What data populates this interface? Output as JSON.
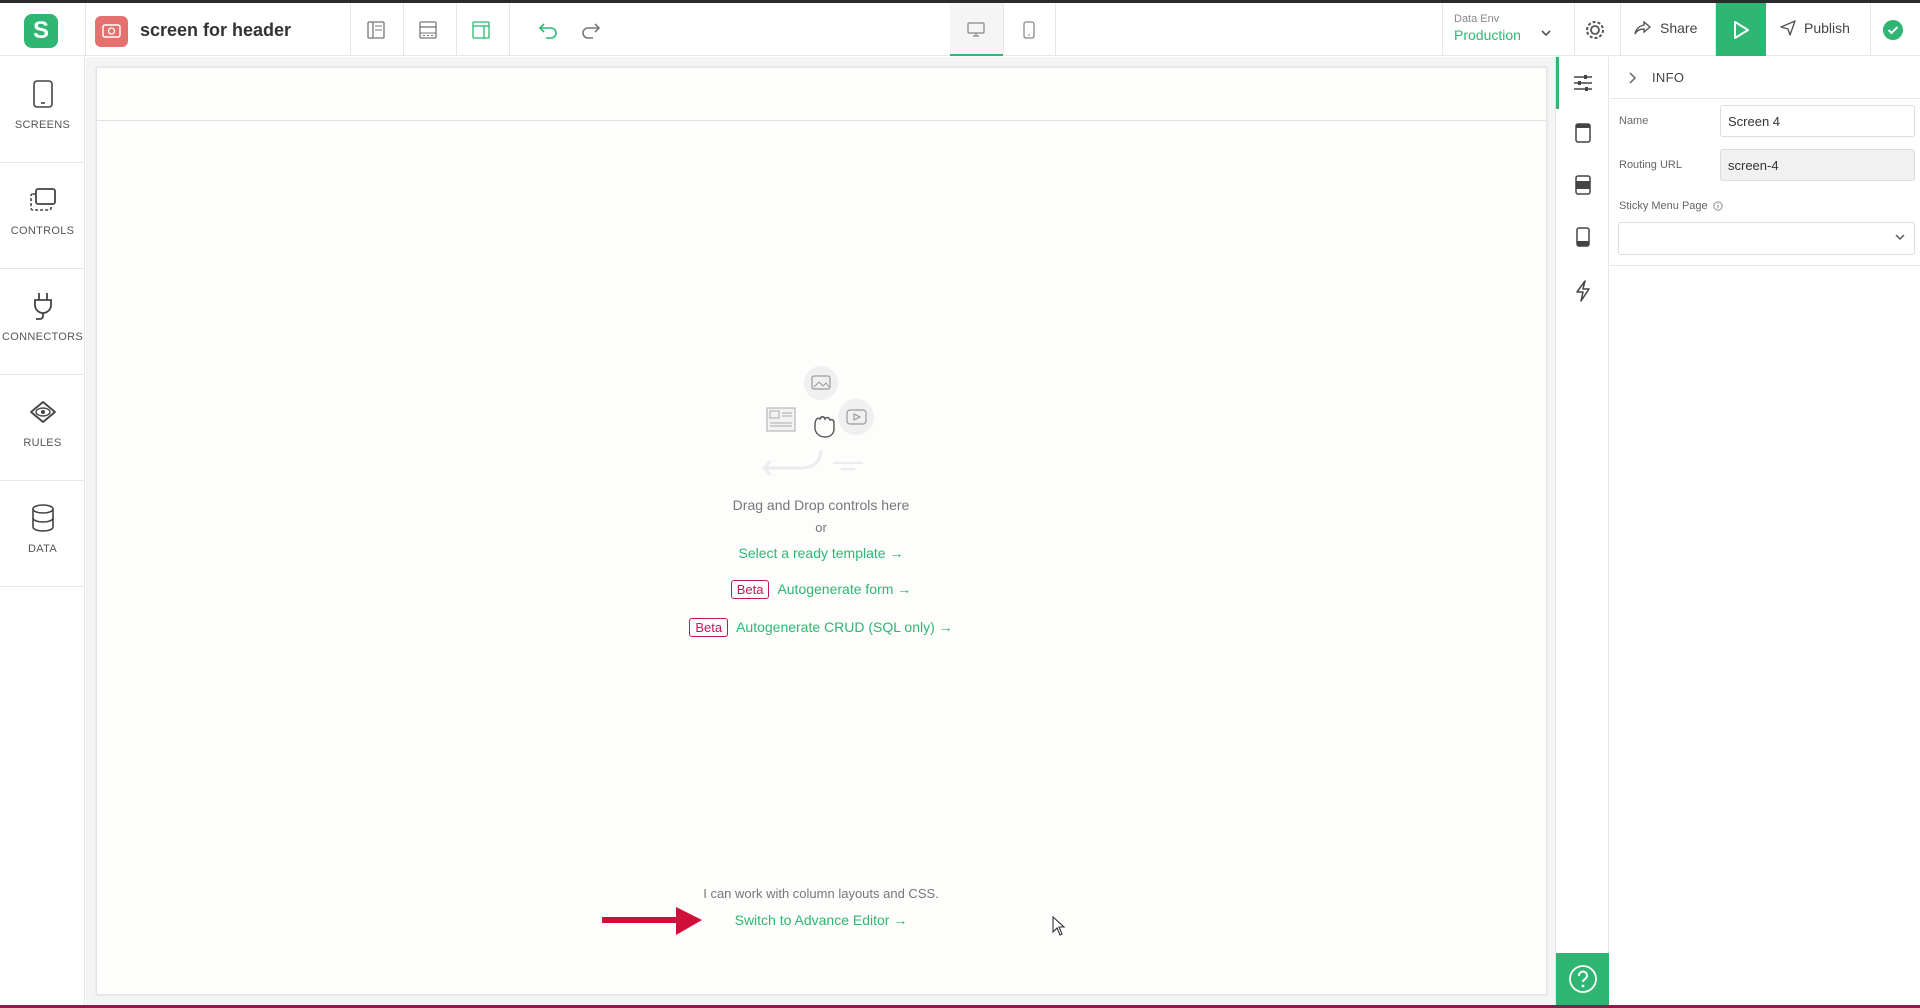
{
  "header": {
    "app_title": "screen for header",
    "data_env_label": "Data Env",
    "data_env_value": "Production",
    "share_label": "Share",
    "publish_label": "Publish"
  },
  "sidebar": {
    "items": [
      {
        "label": "SCREENS",
        "icon": "tablet-icon"
      },
      {
        "label": "CONTROLS",
        "icon": "controls-icon"
      },
      {
        "label": "CONNECTORS",
        "icon": "plug-icon"
      },
      {
        "label": "RULES",
        "icon": "eye-icon"
      },
      {
        "label": "DATA",
        "icon": "database-icon"
      }
    ]
  },
  "canvas": {
    "drag_drop_text": "Drag and Drop controls here",
    "or_text": "or",
    "select_template": "Select a ready template →",
    "beta_badge": "Beta",
    "autogen_form": "Autogenerate form →",
    "autogen_crud": "Autogenerate CRUD (SQL only) →",
    "column_layouts_text": "I can work with column layouts and CSS.",
    "switch_advance": "Switch to Advance Editor →"
  },
  "properties": {
    "section_title": "INFO",
    "name_label": "Name",
    "name_value": "Screen 4",
    "routing_label": "Routing URL",
    "routing_value": "screen-4",
    "sticky_label": "Sticky Menu Page",
    "sticky_value": ""
  },
  "colors": {
    "accent": "#2fb672",
    "beta": "#c2185b",
    "arrow": "#d0103a"
  }
}
